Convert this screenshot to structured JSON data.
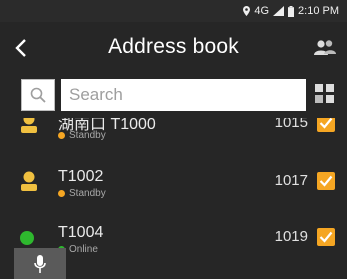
{
  "status_bar": {
    "network": "4G",
    "time": "2:10 PM",
    "icons": [
      "location-icon",
      "signal-icon",
      "battery-icon"
    ]
  },
  "header": {
    "title": "Address book",
    "back_icon": "back-arrow-icon",
    "contacts_icon": "contacts-icon"
  },
  "search": {
    "placeholder": "Search",
    "icon": "search-icon",
    "view_toggle_icon": "grid-view-icon"
  },
  "contacts": [
    {
      "name": "湖南口 T1000",
      "status": "Standby",
      "extension": "1015",
      "checked": true,
      "status_color": "#f5a623"
    },
    {
      "name": "T1002",
      "status": "Standby",
      "extension": "1017",
      "checked": true,
      "status_color": "#f5a623"
    },
    {
      "name": "T1004",
      "status": "Online",
      "extension": "1019",
      "checked": true,
      "status_color": "#2eb82e"
    }
  ],
  "fab": {
    "icon": "microphone-icon"
  },
  "colors": {
    "background": "#262626",
    "accent": "#f5a623",
    "online": "#2eb82e",
    "avatar": "#f0c040"
  }
}
